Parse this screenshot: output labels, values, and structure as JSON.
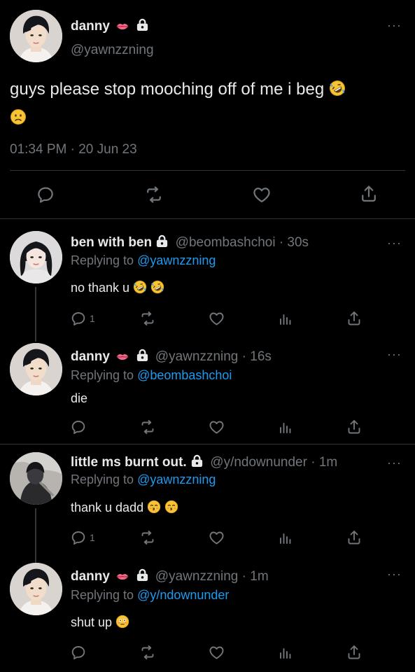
{
  "main_tweet": {
    "display_name": "danny",
    "handle": "@yawnzzning",
    "text": "guys please stop mooching off of me i beg",
    "timestamp": "01:34 PM · 20 Jun 23"
  },
  "replies": [
    {
      "display_name": "ben with ben",
      "handle_time": "@beombashchoi · 30s",
      "replying_prefix": "Replying to ",
      "replying_to": "@yawnzzning",
      "text": "no thank u",
      "reply_count": "1"
    },
    {
      "display_name": "danny",
      "handle_time": "@yawnzzning · 16s",
      "replying_prefix": "Replying to ",
      "replying_to": "@beombashchoi",
      "text": "die",
      "reply_count": ""
    },
    {
      "display_name": "little ms burnt out.",
      "handle_time": "@y/ndownunder · 1m",
      "replying_prefix": "Replying to ",
      "replying_to": "@yawnzzning",
      "text": "thank u dadd",
      "reply_count": "1"
    },
    {
      "display_name": "danny",
      "handle_time": "@yawnzzning · 1m",
      "replying_prefix": "Replying to ",
      "replying_to": "@y/ndownunder",
      "text": "shut up",
      "reply_count": ""
    }
  ],
  "colors": {
    "background": "#000000",
    "text": "#e7e9ea",
    "muted": "#71767b",
    "link": "#1d9bf0",
    "divider": "#2f3336"
  },
  "icons": [
    "more-icon",
    "lock-icon",
    "lips-icon",
    "reply-icon",
    "retweet-icon",
    "like-icon",
    "views-icon",
    "share-icon"
  ]
}
